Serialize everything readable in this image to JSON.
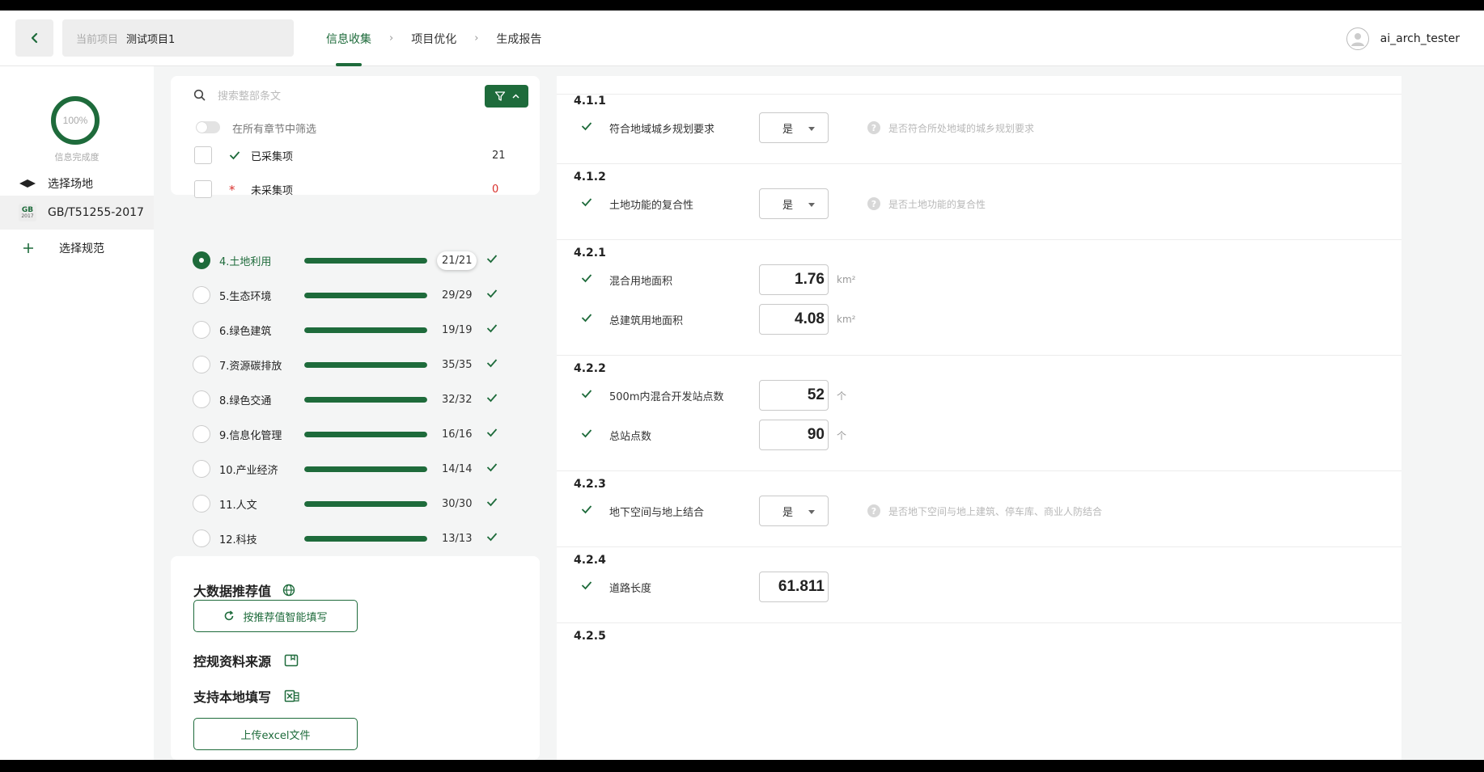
{
  "header": {
    "current_project_label": "当前项目",
    "current_project_value": "测试项目1",
    "steps": [
      {
        "label": "信息收集"
      },
      {
        "label": "项目优化"
      },
      {
        "label": "生成报告"
      }
    ],
    "user_name": "ai_arch_tester"
  },
  "sidebar": {
    "completion_percent": "100%",
    "completion_fraction": 1.0,
    "completion_caption": "信息完成度",
    "items": [
      {
        "label": "选择场地",
        "icon": "layers-icon"
      },
      {
        "label": "GB/T51255-2017",
        "icon": "gb-standard-icon",
        "badge_top": "GB",
        "badge_bottom": "2017"
      },
      {
        "label": "选择规范",
        "icon": "plus-icon"
      }
    ]
  },
  "filter": {
    "search_placeholder": "搜索整部条文",
    "toggle_label": "在所有章节中筛选",
    "collected_label": "已采集项",
    "collected_count": "21",
    "uncollected_label": "未采集项",
    "uncollected_count": "0"
  },
  "chapters": [
    {
      "title": "4.土地利用",
      "count": "21/21",
      "progress": 1.0,
      "selected": true
    },
    {
      "title": "5.生态环境",
      "count": "29/29",
      "progress": 1.0
    },
    {
      "title": "6.绿色建筑",
      "count": "19/19",
      "progress": 1.0
    },
    {
      "title": "7.资源碳排放",
      "count": "35/35",
      "progress": 1.0
    },
    {
      "title": "8.绿色交通",
      "count": "32/32",
      "progress": 1.0
    },
    {
      "title": "9.信息化管理",
      "count": "16/16",
      "progress": 1.0
    },
    {
      "title": "10.产业经济",
      "count": "14/14",
      "progress": 1.0
    },
    {
      "title": "11.人文",
      "count": "30/30",
      "progress": 1.0
    },
    {
      "title": "12.科技",
      "count": "13/13",
      "progress": 1.0
    }
  ],
  "tools": {
    "bigdata_title": "大数据推荐值",
    "smart_fill_button": "按推荐值智能填写",
    "source_title": "控规资料来源",
    "local_fill_title": "支持本地填写",
    "upload_button": "上传excel文件"
  },
  "sections": [
    {
      "code": "4.1.1",
      "fields": [
        {
          "label": "符合地域城乡规划要求",
          "type": "select",
          "value": "是",
          "hint": "是否符合所处地域的城乡规划要求"
        }
      ]
    },
    {
      "code": "4.1.2",
      "fields": [
        {
          "label": "土地功能的复合性",
          "type": "select",
          "value": "是",
          "hint": "是否土地功能的复合性"
        }
      ]
    },
    {
      "code": "4.2.1",
      "fields": [
        {
          "label": "混合用地面积",
          "type": "number",
          "value": "1.76",
          "unit": "km²"
        },
        {
          "label": "总建筑用地面积",
          "type": "number",
          "value": "4.08",
          "unit": "km²"
        }
      ]
    },
    {
      "code": "4.2.2",
      "fields": [
        {
          "label": "500m内混合开发站点数",
          "type": "number",
          "value": "52",
          "unit": "个"
        },
        {
          "label": "总站点数",
          "type": "number",
          "value": "90",
          "unit": "个"
        }
      ]
    },
    {
      "code": "4.2.3",
      "fields": [
        {
          "label": "地下空间与地上结合",
          "type": "select",
          "value": "是",
          "hint": "是否地下空间与地上建筑、停车库、商业人防结合"
        }
      ]
    },
    {
      "code": "4.2.4",
      "fields": [
        {
          "label": "道路长度",
          "type": "number",
          "value": "61.811"
        }
      ]
    },
    {
      "code": "4.2.5",
      "fields": []
    }
  ],
  "colors": {
    "accent": "#1e6b3b",
    "uncollected_star": "#d9302c",
    "uncollected_count": "#d9302c"
  }
}
